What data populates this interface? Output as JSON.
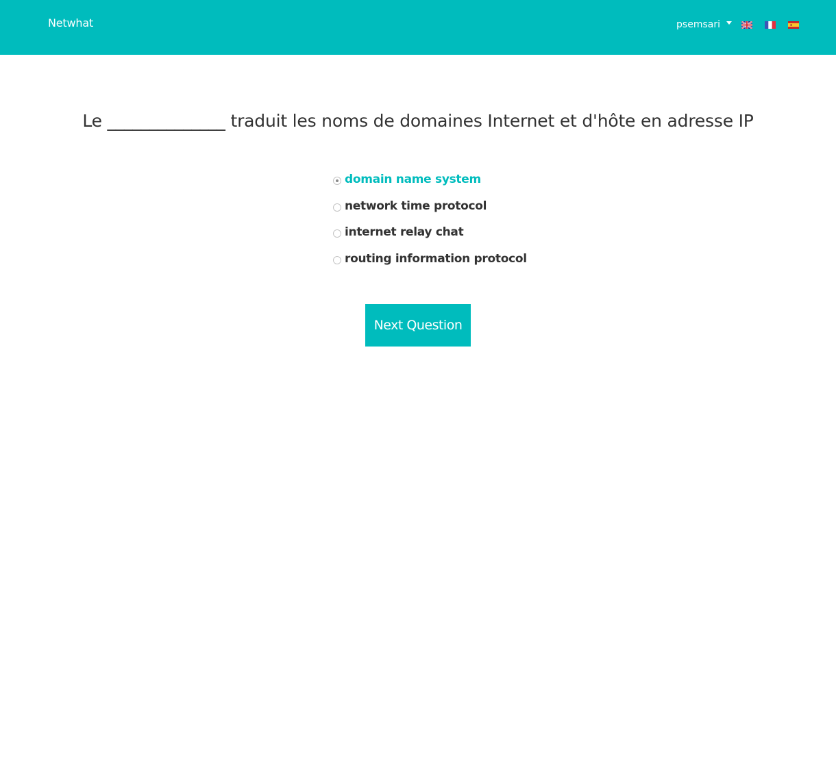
{
  "navbar": {
    "brand": "Netwhat",
    "user": "psemsari",
    "languages": [
      {
        "code": "en",
        "icon": "uk-flag-icon"
      },
      {
        "code": "fr",
        "icon": "france-flag-icon"
      },
      {
        "code": "es",
        "icon": "spain-flag-icon"
      }
    ],
    "background_color": "#00bcbd"
  },
  "quiz": {
    "question": "Le ______________ traduit les noms de domaines Internet et d'hôte en adresse IP",
    "options": [
      {
        "label": "domain name system",
        "selected": true
      },
      {
        "label": "network time protocol",
        "selected": false
      },
      {
        "label": "internet relay chat",
        "selected": false
      },
      {
        "label": "routing information protocol",
        "selected": false
      }
    ],
    "next_label": "Next Question",
    "accent_color": "#00bcbd"
  }
}
